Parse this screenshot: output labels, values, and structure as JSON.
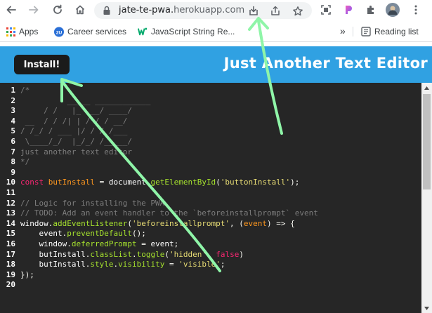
{
  "browser": {
    "url_main": "jate-te-pwa.",
    "url_domain": "herokuapp.com",
    "icons": [
      "back-arrow-icon",
      "forward-arrow-icon",
      "reload-icon",
      "home-icon",
      "lock-icon",
      "install-app-icon",
      "share-icon",
      "star-icon",
      "screen-capture-icon",
      "extension-logo-icon",
      "puzzle-piece-icon",
      "profile-avatar-icon",
      "kebab-menu-icon"
    ]
  },
  "bookmarks": {
    "items": [
      {
        "label": "Apps"
      },
      {
        "label": "Career services"
      },
      {
        "label": "JavaScript String Re..."
      }
    ],
    "overflow": "»",
    "reading_list": "Reading list"
  },
  "page": {
    "install_label": "Install!",
    "title": "Just Another Text Editor"
  },
  "editor": {
    "lines": [
      {
        "n": "1",
        "tokens": [
          {
            "c": "t-cm",
            "t": "/*"
          }
        ]
      },
      {
        "n": "2",
        "tokens": [
          {
            "c": "t-cm",
            "t": "          _____ ____________"
          }
        ]
      },
      {
        "n": "3",
        "tokens": [
          {
            "c": "t-cm",
            "t": "     / /   |_  __/ ____/"
          }
        ]
      },
      {
        "n": "4",
        "tokens": [
          {
            "c": "t-cm",
            "t": " __  / / /| | / / / __/"
          }
        ]
      },
      {
        "n": "5",
        "tokens": [
          {
            "c": "t-cm",
            "t": "/ /_/ / ___ |/ / / /___"
          }
        ]
      },
      {
        "n": "6",
        "tokens": [
          {
            "c": "t-cm",
            "t": " \\____/_/  |_/_/ /_____/"
          }
        ]
      },
      {
        "n": "7",
        "tokens": [
          {
            "c": "t-cm",
            "t": "just another text editor"
          }
        ]
      },
      {
        "n": "8",
        "tokens": [
          {
            "c": "t-cm",
            "t": "*/"
          }
        ]
      },
      {
        "n": "9",
        "tokens": []
      },
      {
        "n": "10",
        "tokens": [
          {
            "c": "t-kw",
            "t": "const "
          },
          {
            "c": "t-var",
            "t": "butInstall"
          },
          {
            "c": "t-pl",
            "t": " = "
          },
          {
            "c": "t-obj",
            "t": "document"
          },
          {
            "c": "t-pl",
            "t": "."
          },
          {
            "c": "t-fn",
            "t": "getElementById"
          },
          {
            "c": "t-pl",
            "t": "("
          },
          {
            "c": "t-str",
            "t": "'buttonInstall'"
          },
          {
            "c": "t-pl",
            "t": ");"
          }
        ]
      },
      {
        "n": "11",
        "tokens": []
      },
      {
        "n": "12",
        "tokens": [
          {
            "c": "t-cm",
            "t": "// Logic for installing the PWA"
          }
        ]
      },
      {
        "n": "13",
        "tokens": [
          {
            "c": "t-cm",
            "t": "// TODO: Add an event handler to the `beforeinstallprompt` event"
          }
        ]
      },
      {
        "n": "14",
        "tokens": [
          {
            "c": "t-obj",
            "t": "window"
          },
          {
            "c": "t-pl",
            "t": "."
          },
          {
            "c": "t-fn",
            "t": "addEventListener"
          },
          {
            "c": "t-pl",
            "t": "("
          },
          {
            "c": "t-str",
            "t": "'beforeinstallprompt'"
          },
          {
            "c": "t-pl",
            "t": ", ("
          },
          {
            "c": "t-var",
            "t": "event"
          },
          {
            "c": "t-pl",
            "t": ") => {"
          }
        ]
      },
      {
        "n": "15",
        "tokens": [
          {
            "c": "t-pl",
            "t": "    "
          },
          {
            "c": "t-obj",
            "t": "event"
          },
          {
            "c": "t-pl",
            "t": "."
          },
          {
            "c": "t-fn",
            "t": "preventDefault"
          },
          {
            "c": "t-pl",
            "t": "();"
          }
        ]
      },
      {
        "n": "16",
        "tokens": [
          {
            "c": "t-pl",
            "t": "    "
          },
          {
            "c": "t-obj",
            "t": "window"
          },
          {
            "c": "t-pl",
            "t": "."
          },
          {
            "c": "t-fn",
            "t": "deferredPrompt"
          },
          {
            "c": "t-pl",
            "t": " = "
          },
          {
            "c": "t-obj",
            "t": "event"
          },
          {
            "c": "t-pl",
            "t": ";"
          }
        ]
      },
      {
        "n": "17",
        "tokens": [
          {
            "c": "t-pl",
            "t": "    "
          },
          {
            "c": "t-obj",
            "t": "butInstall"
          },
          {
            "c": "t-pl",
            "t": "."
          },
          {
            "c": "t-fn",
            "t": "classList"
          },
          {
            "c": "t-pl",
            "t": "."
          },
          {
            "c": "t-fn",
            "t": "toggle"
          },
          {
            "c": "t-pl",
            "t": "("
          },
          {
            "c": "t-str",
            "t": "'hidden'"
          },
          {
            "c": "t-pl",
            "t": ", "
          },
          {
            "c": "t-kw",
            "t": "false"
          },
          {
            "c": "t-pl",
            "t": ")"
          }
        ]
      },
      {
        "n": "18",
        "tokens": [
          {
            "c": "t-pl",
            "t": "    "
          },
          {
            "c": "t-obj",
            "t": "butInstall"
          },
          {
            "c": "t-pl",
            "t": "."
          },
          {
            "c": "t-fn",
            "t": "style"
          },
          {
            "c": "t-pl",
            "t": "."
          },
          {
            "c": "t-fn",
            "t": "visibility"
          },
          {
            "c": "t-pl",
            "t": " = "
          },
          {
            "c": "t-str",
            "t": "'visible'"
          },
          {
            "c": "t-pl",
            "t": ";"
          }
        ]
      },
      {
        "n": "19",
        "tokens": [
          {
            "c": "t-pl",
            "t": "});"
          }
        ]
      },
      {
        "n": "20",
        "tokens": []
      }
    ]
  },
  "colors": {
    "header_bg": "#30a1e2",
    "editor_bg": "#262626",
    "annotation_arrow": "#8ff5a8"
  }
}
